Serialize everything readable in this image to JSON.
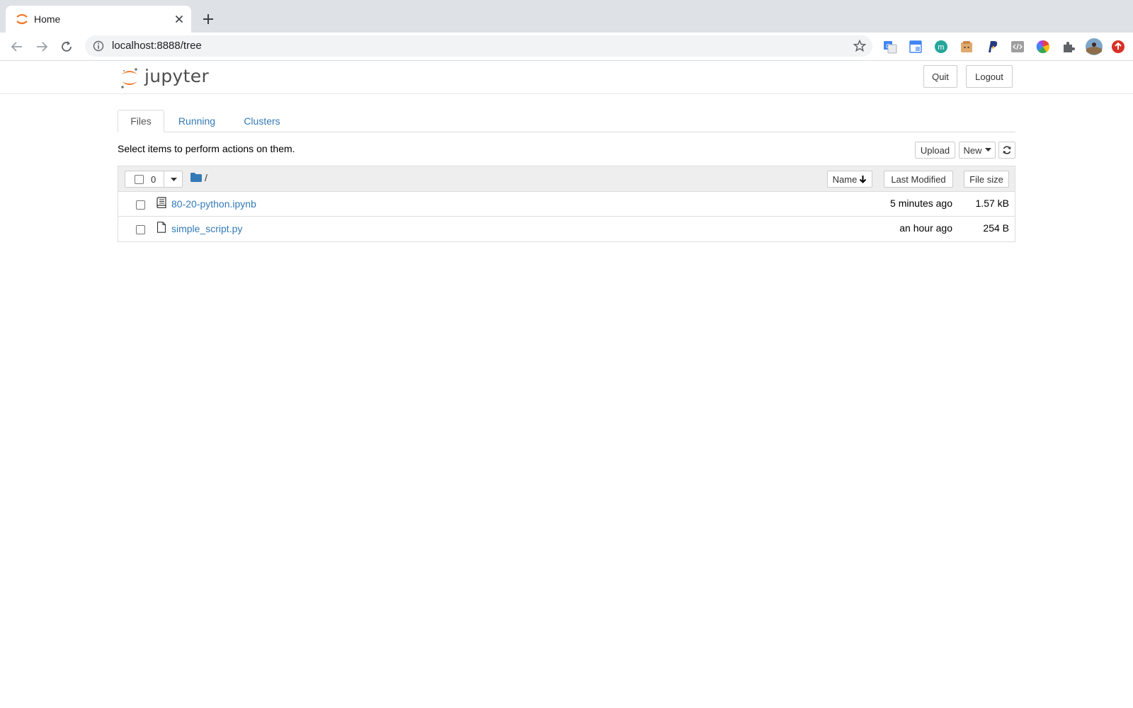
{
  "browser": {
    "tab_title": "Home",
    "url": "localhost:8888/tree",
    "extensions": [
      "translate-icon",
      "window-extension-icon",
      "m-extension-icon",
      "folder-extension-icon",
      "paypal-icon",
      "code-extension-icon",
      "color-wheel-icon",
      "puzzle-icon",
      "profile-avatar",
      "update-icon"
    ]
  },
  "header": {
    "logo_text": "jupyter",
    "quit_label": "Quit",
    "logout_label": "Logout"
  },
  "tabs": [
    {
      "label": "Files",
      "active": true
    },
    {
      "label": "Running",
      "active": false
    },
    {
      "label": "Clusters",
      "active": false
    }
  ],
  "toolbar": {
    "hint": "Select items to perform actions on them.",
    "upload_label": "Upload",
    "new_label": "New"
  },
  "list": {
    "selected_count": "0",
    "path": "/",
    "sort_name_label": "Name",
    "sort_modified_label": "Last Modified",
    "sort_size_label": "File size",
    "items": [
      {
        "name": "80-20-python.ipynb",
        "type": "notebook",
        "modified": "5 minutes ago",
        "size": "1.57 kB"
      },
      {
        "name": "simple_script.py",
        "type": "file",
        "modified": "an hour ago",
        "size": "254 B"
      }
    ]
  },
  "colors": {
    "link": "#337ab7",
    "jupyter_orange": "#f37726",
    "chrome_bg": "#dee1e6"
  }
}
